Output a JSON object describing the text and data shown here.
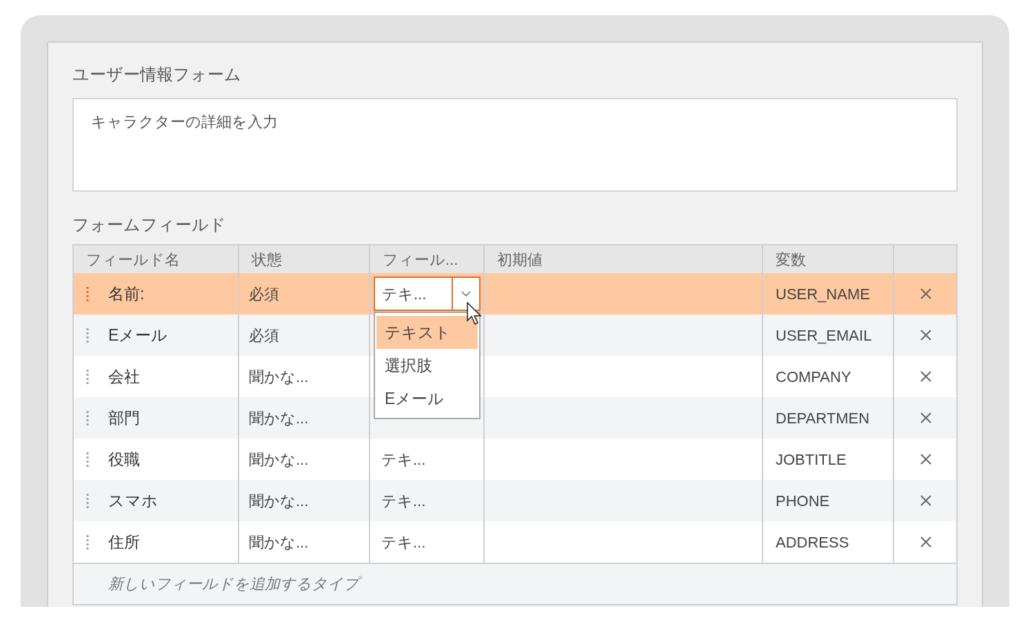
{
  "form_title": "ユーザー情報フォーム",
  "description": {
    "placeholder": "キャラクターの詳細を入力"
  },
  "fields_section_title": "フォームフィールド",
  "table": {
    "columns": [
      "フィールド名",
      "状態",
      "フィール...",
      "初期値",
      "変数"
    ],
    "rows": [
      {
        "name": "名前:",
        "status": "必須",
        "type_select": {
          "value": "テキ...",
          "open": true,
          "options": [
            {
              "label": "テキスト",
              "selected": true
            },
            {
              "label": "選択肢",
              "selected": false
            },
            {
              "label": "Eメール",
              "selected": false
            }
          ]
        },
        "variable": "USER_NAME",
        "selected": true
      },
      {
        "name": "Eメール",
        "status": "必須",
        "variable": "USER_EMAIL",
        "selected": false
      },
      {
        "name": "会社",
        "status": "聞かな...",
        "variable": "COMPANY",
        "selected": false
      },
      {
        "name": "部門",
        "status": "聞かな...",
        "variable": "DEPARTMEN",
        "selected": false
      },
      {
        "name": "役職",
        "status": "聞かな...",
        "type": "テキ...",
        "variable": "JOBTITLE",
        "selected": false
      },
      {
        "name": "スマホ",
        "status": "聞かな...",
        "type": "テキ...",
        "variable": "PHONE",
        "selected": false
      },
      {
        "name": "住所",
        "status": "聞かな...",
        "type": "テキ...",
        "variable": "ADDRESS",
        "selected": false
      }
    ],
    "new_field": {
      "placeholder": "新しいフィールドを追加するタイプ"
    }
  }
}
